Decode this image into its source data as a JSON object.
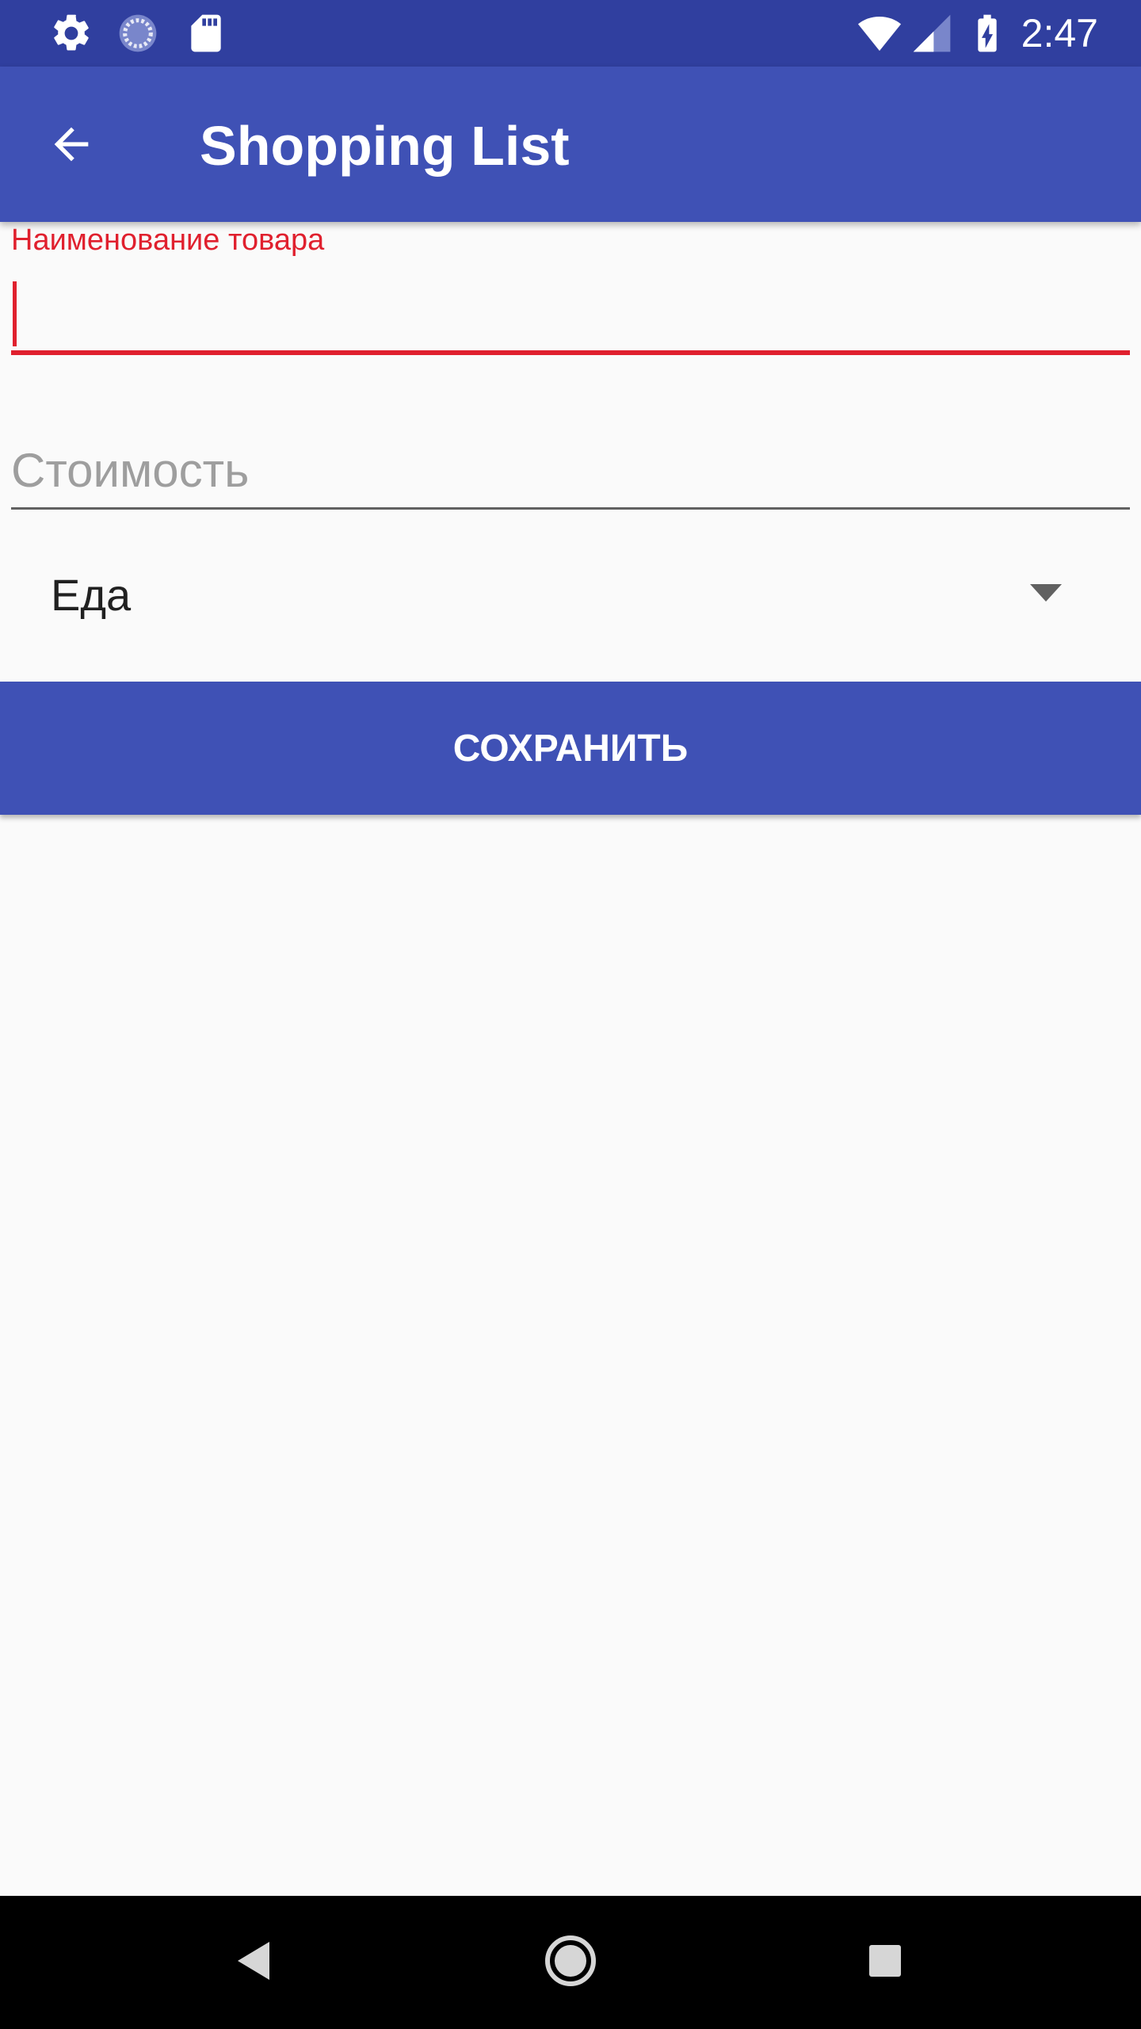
{
  "status_bar": {
    "time": "2:47",
    "left_icons": [
      "settings-icon",
      "sync-icon",
      "sd-card-icon"
    ],
    "right_icons": [
      "wifi-icon",
      "cell-signal-icon",
      "battery-charging-icon"
    ]
  },
  "app_bar": {
    "title": "Shopping List",
    "back_icon": "arrow-back-icon"
  },
  "form": {
    "name_field": {
      "label": "Наименование товара",
      "value": "",
      "state": "focused-error"
    },
    "price_field": {
      "placeholder": "Стоимость",
      "value": ""
    },
    "category_spinner": {
      "selected": "Еда"
    },
    "save_label": "СОХРАНИТЬ"
  },
  "nav_bar": {
    "buttons": [
      "back-triangle-icon",
      "home-circle-icon",
      "recents-square-icon"
    ]
  },
  "colors": {
    "primary": "#3F51B5",
    "primary_dark": "#303F9F",
    "error": "#E0202E",
    "background": "#FAFAFA"
  }
}
